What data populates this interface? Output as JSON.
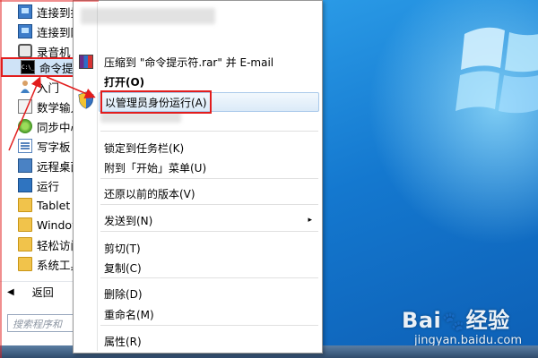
{
  "start_menu": {
    "programs": [
      {
        "label": "连接到投",
        "icon": "network-projector-icon"
      },
      {
        "label": "连接到网",
        "icon": "network-icon"
      },
      {
        "label": "录音机",
        "icon": "sound-recorder-icon"
      },
      {
        "label": "命令提示",
        "icon": "command-prompt-icon"
      },
      {
        "label": "入门",
        "icon": "getting-started-icon"
      },
      {
        "label": "数学输入",
        "icon": "math-input-icon"
      },
      {
        "label": "同步中心",
        "icon": "sync-center-icon"
      },
      {
        "label": "写字板",
        "icon": "wordpad-icon"
      },
      {
        "label": "远程桌面",
        "icon": "remote-desktop-icon"
      },
      {
        "label": "运行",
        "icon": "run-icon"
      },
      {
        "label": "Tablet P",
        "icon": "folder-icon"
      },
      {
        "label": "Window",
        "icon": "folder-icon"
      },
      {
        "label": "轻松访问",
        "icon": "folder-icon"
      },
      {
        "label": "系统工具",
        "icon": "folder-icon"
      }
    ],
    "selected_index": 3,
    "back_label": "返回",
    "search_placeholder": "搜索程序和"
  },
  "context_menu": {
    "items": [
      {
        "label": "压缩到 \"命令提示符.rar\" 并 E-mail",
        "icon": "winrar-icon"
      },
      {
        "label": "打开(O)",
        "bold": true
      },
      {
        "label": "以管理员身份运行(A)",
        "icon": "uac-shield-icon",
        "highlighted": true
      },
      {
        "label": "锁定到任务栏(K)"
      },
      {
        "label": "附到「开始」菜单(U)"
      },
      {
        "label": "还原以前的版本(V)"
      },
      {
        "label": "发送到(N)",
        "submenu": true
      },
      {
        "label": "剪切(T)"
      },
      {
        "label": "复制(C)"
      },
      {
        "label": "删除(D)"
      },
      {
        "label": "重命名(M)"
      },
      {
        "label": "属性(R)"
      }
    ]
  },
  "watermark": {
    "brand": "Bai",
    "brand_suffix": "经验",
    "url": "jingyan.baidu.com"
  },
  "colors": {
    "annotation_red": "#e21d1d",
    "highlight_border": "#a9c9ea",
    "desktop_blue": "#1478cf"
  },
  "arrow_glyph": "▸",
  "back_glyph": "◀"
}
